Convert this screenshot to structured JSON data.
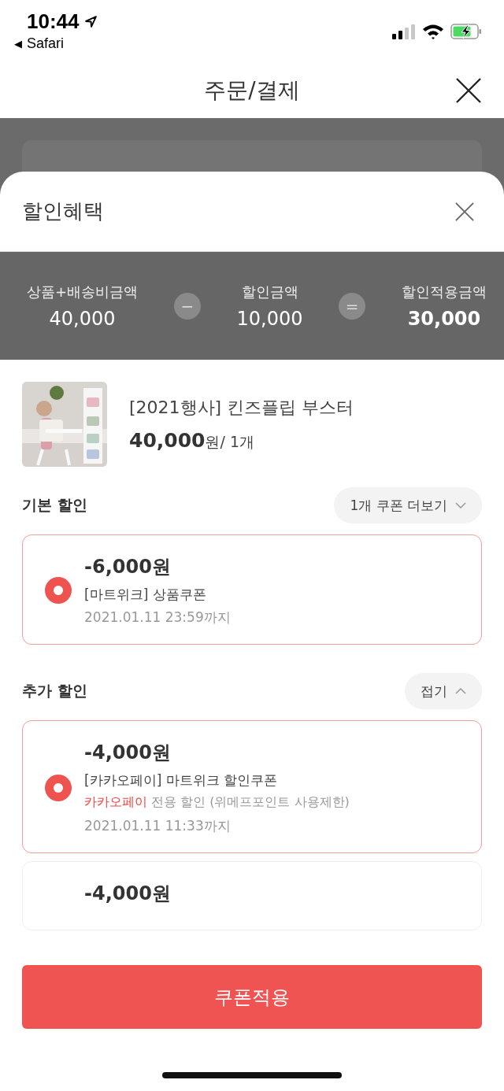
{
  "status_bar": {
    "time": "10:44",
    "back_arrow": "◀",
    "back_app": "Safari"
  },
  "header": {
    "title": "주문/결제"
  },
  "sheet": {
    "title": "할인혜택",
    "summary": [
      {
        "kind": "value",
        "label": "상품+배송비금액",
        "amount": "40,000"
      },
      {
        "kind": "operator",
        "symbol": "−"
      },
      {
        "kind": "value",
        "label": "할인금액",
        "amount": "10,000"
      },
      {
        "kind": "operator",
        "symbol": "="
      },
      {
        "kind": "total",
        "label": "할인적용금액",
        "amount": "30,000"
      }
    ],
    "product": {
      "name": "[2021행사] 킨즈플립 부스터",
      "price": "40,000",
      "price_unit": "원/ 1개"
    },
    "sections": [
      {
        "title": "기본 할인",
        "toggle": {
          "label": "1개 쿠폰 더보기",
          "expanded": false
        },
        "coupons": [
          {
            "amount": "-6,000원",
            "name": "[마트위크] 상품쿠폰",
            "expiry": "2021.01.11 23:59까지",
            "selected": true
          }
        ]
      },
      {
        "title": "추가 할인",
        "toggle": {
          "label": "접기",
          "expanded": true
        },
        "coupons": [
          {
            "amount": "-4,000원",
            "name": "[카카오페이] 마트위크 할인쿠폰",
            "note_highlight": "카카오페이",
            "note": "전용 할인 (위메프포인트 사용제한)",
            "expiry": "2021.01.11 11:33까지",
            "selected": true
          },
          {
            "amount": "-4,000원",
            "selected": false
          }
        ]
      }
    ],
    "apply_button": "쿠폰적용"
  }
}
